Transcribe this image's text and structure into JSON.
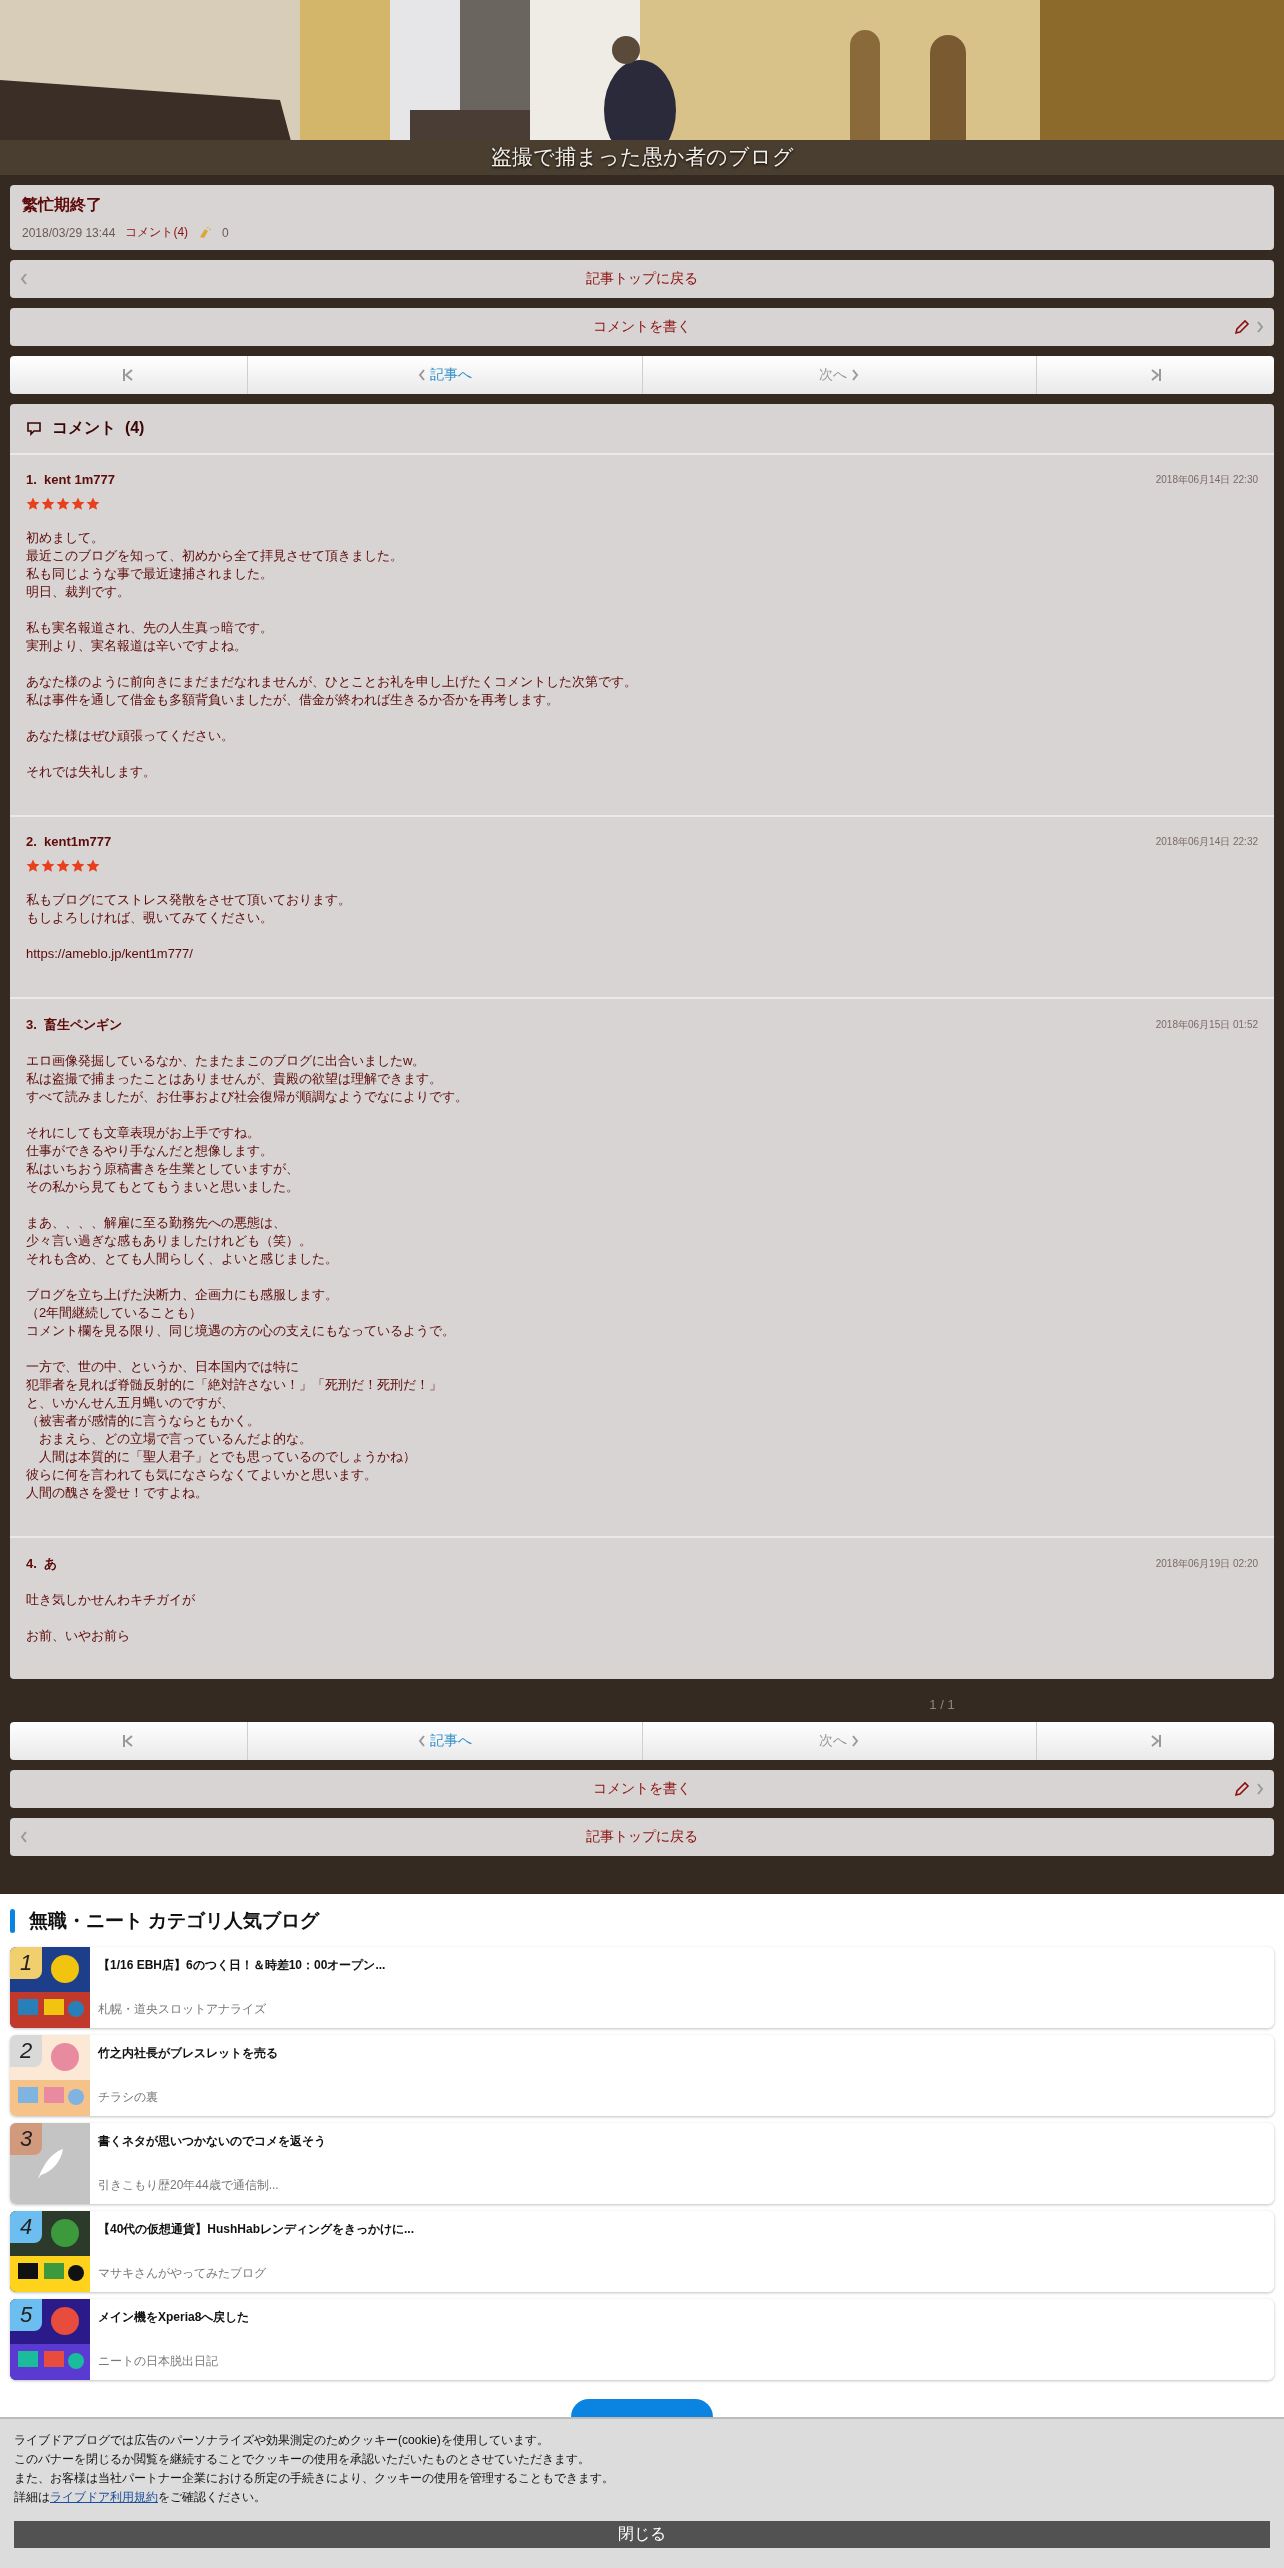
{
  "header": {
    "blog_title": "盗撮で捕まった愚か者のブログ"
  },
  "article": {
    "title": "繁忙期終了",
    "date": "2018/03/29 13:44",
    "comments_link": "コメント(4)",
    "claps": "0"
  },
  "top_buttons": [
    {
      "kind": "back",
      "label": "記事トップに戻る"
    },
    {
      "kind": "write",
      "label": "コメントを書く"
    }
  ],
  "top_pager": {
    "prev": {
      "label": "記事へ",
      "disabled": false
    },
    "next": {
      "label": "次へ",
      "disabled": true
    }
  },
  "comments_section": {
    "title": "コメント",
    "count": "(4)"
  },
  "comments": [
    {
      "number": "1.",
      "name": "kent 1m777",
      "date": "2018年06月14日 22:30",
      "stars": 5,
      "paragraphs": [
        [
          "初めまして。",
          "最近このブログを知って、初めから全て拝見させて頂きました。",
          "私も同じような事で最近逮捕されました。",
          "明日、裁判です。"
        ],
        [
          "私も実名報道され、先の人生真っ暗です。",
          "実刑より、実名報道は辛いですよね。"
        ],
        [
          "あなた様のように前向きにまだまだなれませんが、ひとことお礼を申し上げたくコメントした次第です。",
          "私は事件を通して借金も多額背負いましたが、借金が終われば生きるか否かを再考します。"
        ],
        [
          "あなた様はぜひ頑張ってください。"
        ],
        [
          "それでは失礼します。"
        ]
      ]
    },
    {
      "number": "2.",
      "name": "kent1m777",
      "date": "2018年06月14日 22:32",
      "stars": 5,
      "paragraphs": [
        [
          "私もブログにてストレス発散をさせて頂いております。",
          "もしよろしければ、覗いてみてください。"
        ],
        [
          "https://ameblo.jp/kent1m777/"
        ]
      ]
    },
    {
      "number": "3.",
      "name": "畜生ペンギン",
      "date": "2018年06月15日 01:52",
      "paragraphs": [
        [
          "エロ画像発掘しているなか、たまたまこのブログに出合いましたw。",
          "私は盗撮で捕まったことはありませんが、貴殿の欲望は理解できます。",
          "すべて読みましたが、お仕事および社会復帰が順調なようでなによりです。"
        ],
        [
          "それにしても文章表現がお上手ですね。",
          "仕事ができるやり手なんだと想像します。",
          "私はいちおう原稿書きを生業としていますが、",
          "その私から見てもとてもうまいと思いました。"
        ],
        [
          "まあ、、、、解雇に至る勤務先への悪態は、",
          "少々言い過ぎな感もありましたけれども（笑）。",
          "それも含め、とても人間らしく、よいと感じました。"
        ],
        [
          "ブログを立ち上げた決断力、企画力にも感服します。",
          "（2年間継続していることも）",
          "コメント欄を見る限り、同じ境遇の方の心の支えにもなっているようで。"
        ],
        [
          "一方で、世の中、というか、日本国内では特に",
          "犯罪者を見れば脊髄反射的に「絶対許さない！」「死刑だ！死刑だ！」",
          "と、いかんせん五月蝿いのですが、",
          "（被害者が感情的に言うならともかく。",
          "　おまえら、どの立場で言っているんだよ的な。",
          "　人間は本質的に「聖人君子」とでも思っているのでしょうかね）",
          "彼らに何を言われても気になさらなくてよいかと思います。",
          "人間の醜さを愛せ！ですよね。"
        ]
      ]
    },
    {
      "number": "4.",
      "name": "あ",
      "date": "2018年06月19日 02:20",
      "paragraphs": [
        [
          "吐き気しかせんわキチガイが"
        ],
        [
          "お前、いやお前ら"
        ]
      ]
    }
  ],
  "page_indicator": "1 / 1",
  "bottom_pager": {
    "prev": {
      "label": "記事へ",
      "disabled": false
    },
    "next": {
      "label": "次へ",
      "disabled": true
    }
  },
  "bottom_buttons": [
    {
      "kind": "write",
      "label": "コメントを書く"
    },
    {
      "kind": "back",
      "label": "記事トップに戻る"
    }
  ],
  "popular": {
    "title": "無職・ニート カテゴリ人気ブログ",
    "items": [
      {
        "rank": "1",
        "color": "#f2cf6e",
        "title": "【1/16 EBH店】6のつく日！＆時差10：00オープン...",
        "blog": "札幌・道央スロットアナライズ",
        "kind": "picture"
      },
      {
        "rank": "2",
        "color": "#d9d9d9",
        "title": "竹之内社長がブレスレットを売る",
        "blog": "チラシの裏",
        "kind": "picture"
      },
      {
        "rank": "3",
        "color": "#d29a7c",
        "title": "書くネタが思いつかないのでコメを返そう",
        "blog": "引きこもり歴20年44歳で通信制...",
        "kind": "placeholder"
      },
      {
        "rank": "4",
        "color": "#6cbdf0",
        "title": "【40代の仮想通貨】HushHabレンディングをきっかけに...",
        "blog": "マサキさんがやってみたブログ",
        "kind": "picture"
      },
      {
        "rank": "5",
        "color": "#6cbdf0",
        "title": "メイン機をXperia8へ戻した",
        "blog": "ニートの日本脱出日記",
        "kind": "picture"
      }
    ]
  },
  "cookie_banner": {
    "lines": [
      "ライブドアブログでは広告のパーソナライズや効果測定のためクッキー(cookie)を使用しています。",
      "このバナーを閉じるか閲覧を継続することでクッキーの使用を承認いただいたものとさせていただきます。",
      "また、お客様は当社パートナー企業における所定の手続きにより、クッキーの使用を管理することもできます。"
    ],
    "detail_before": "詳細は",
    "detail_link": "ライブドア利用規約",
    "detail_after": "をご確認ください。",
    "close": "閉じる"
  }
}
